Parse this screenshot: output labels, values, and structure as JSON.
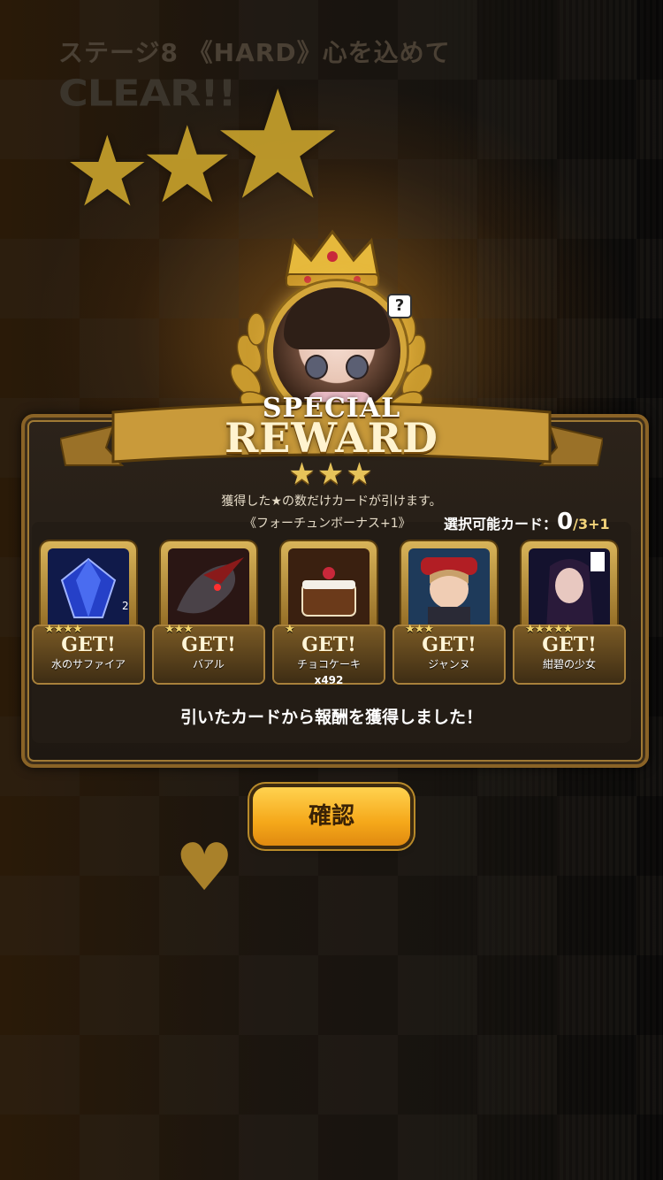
{
  "header": {
    "stage_title": "ステージ8 《HARD》心を込めて",
    "clear_text": "CLEAR!!",
    "stars": [
      "★",
      "★",
      "★"
    ]
  },
  "emblem": {
    "help_label": "?"
  },
  "banner": {
    "line1": "SPECIAL",
    "line2": "REWARD",
    "rank_stars": "★★★"
  },
  "panel": {
    "hint": "獲得した★の数だけカードが引けます。",
    "bonus": "《フォーチュンボーナス+1》",
    "select_label": "選択可能カード：",
    "select_count": "0",
    "select_max": "/3+1",
    "result_message": "引いたカードから報酬を獲得しました！"
  },
  "cards": [
    {
      "name": "水のサファイア",
      "stars": "★★★★",
      "get": "GET!",
      "count": "2",
      "qty": "",
      "art_color": "#1a2a8a"
    },
    {
      "name": "バアル",
      "stars": "★★★",
      "get": "GET!",
      "count": "",
      "qty": "",
      "art_color": "#3a1a1a"
    },
    {
      "name": "チョコケーキ",
      "stars": "★",
      "get": "GET!",
      "count": "",
      "qty": "x492",
      "art_color": "#6a3a1e"
    },
    {
      "name": "ジャンヌ",
      "stars": "★★★",
      "get": "GET!",
      "count": "",
      "qty": "",
      "art_color": "#2a5a8a"
    },
    {
      "name": "紺碧の少女",
      "stars": "★★★★★",
      "get": "GET!",
      "count": "",
      "qty": "",
      "art_color": "#1a1840"
    }
  ],
  "confirm_button": "確認"
}
